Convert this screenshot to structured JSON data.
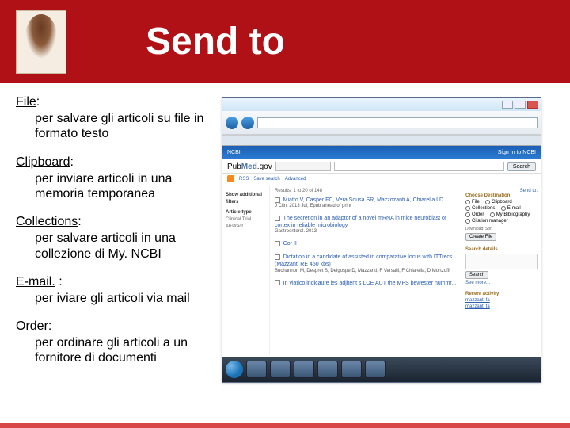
{
  "header": {
    "title": "Send to"
  },
  "items": [
    {
      "label": "File",
      "sep": ": ",
      "desc": "per salvare gli articoli su file in formato testo"
    },
    {
      "label": "Clipboard",
      "sep": ": ",
      "desc": "per inviare articoli in una memoria temporanea"
    },
    {
      "label": "Collections",
      "sep": ": ",
      "desc": "per salvare articoli in una collezione di My. NCBI"
    },
    {
      "label": "E-mail.",
      "sep": " : ",
      "desc": "per iviare gli articoli via mail"
    },
    {
      "label": "Order",
      "sep": ": ",
      "desc": "per ordinare gli articoli a un fornitore di documenti"
    }
  ],
  "screenshot": {
    "banner_left": "NCBI",
    "banner_right": "Sign In to NCBI",
    "search_label": "PubMed",
    "search_button": "Search",
    "rss_label": "RSS",
    "save_search": "Save search",
    "advanced": "Advanced",
    "summary_line": "Results: 1 to 20 of 148",
    "show_filter": "Show additional filters",
    "left_nav": [
      "Article type",
      "Clinical Trial",
      "Abstract"
    ],
    "send_to": "Send to:",
    "choose_dest": "Choose Destination",
    "dest_options": [
      "File",
      "Clipboard",
      "Collections",
      "E-mail",
      "Order",
      "My Bibliography",
      "Citation manager"
    ],
    "create_file": "Create File",
    "search_details": "Search details",
    "recent_activity": "Recent activity",
    "see_more": "See more..."
  }
}
